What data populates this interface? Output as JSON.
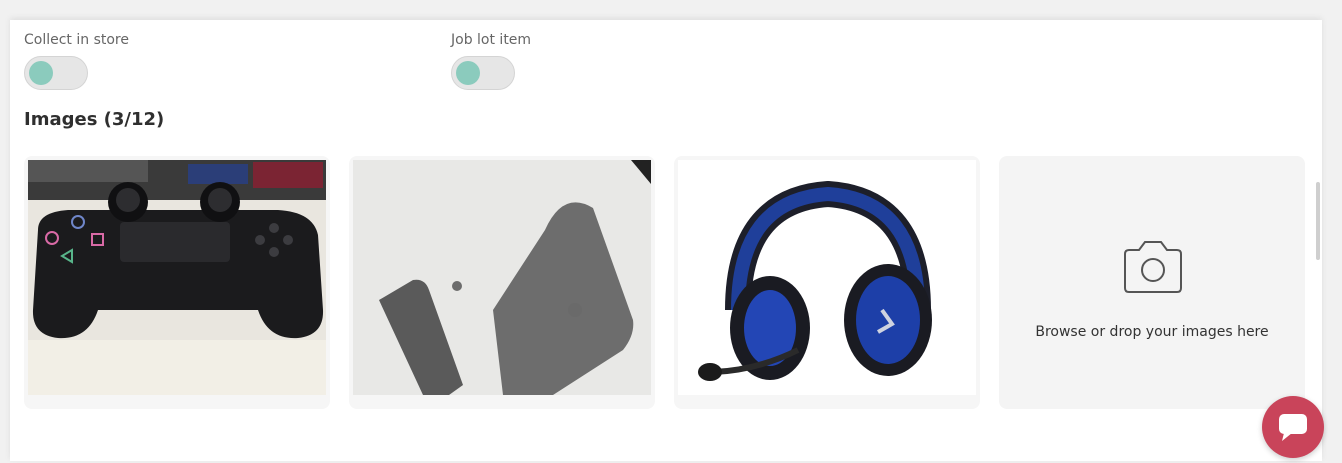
{
  "options": {
    "collect_in_store": {
      "label": "Collect in store",
      "enabled": false
    },
    "job_lot_item": {
      "label": "Job lot item",
      "enabled": false
    }
  },
  "images": {
    "title": "Images (3/12)",
    "uploaded": [
      {
        "subject": "game-controller"
      },
      {
        "subject": "plastic-stand-parts"
      },
      {
        "subject": "gaming-headset"
      }
    ],
    "upload_prompt": "Browse or drop your images here"
  },
  "colors": {
    "toggle_knob": "#8bcbbd",
    "chat_button": "#c9445a"
  },
  "icons": {
    "upload": "camera-icon",
    "chat": "chat-icon"
  }
}
